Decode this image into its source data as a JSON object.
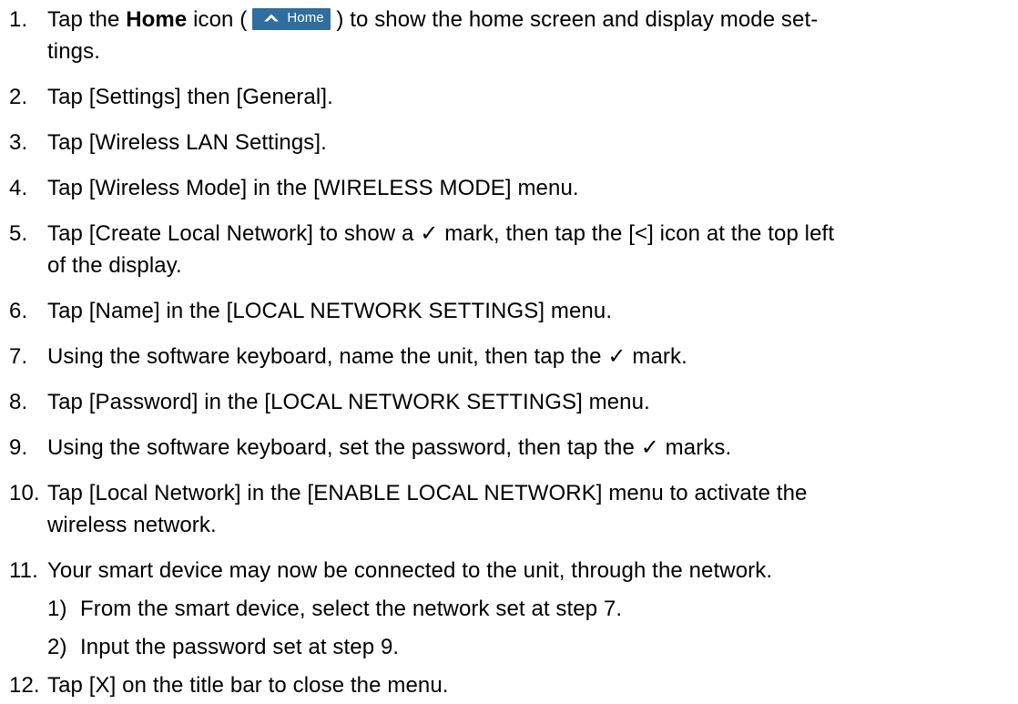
{
  "steps": [
    {
      "number": "1.",
      "lines": [
        {
          "before": "Tap the ",
          "bold": "Home",
          "middle": " icon (",
          "button_label": "Home",
          "after": ") to show the home screen and display mode set-"
        },
        {
          "text": "tings."
        }
      ]
    },
    {
      "number": "2.",
      "lines": [
        {
          "text": "Tap [Settings] then [General]."
        }
      ]
    },
    {
      "number": "3.",
      "lines": [
        {
          "text": "Tap [Wireless LAN Settings]."
        }
      ]
    },
    {
      "number": "4.",
      "lines": [
        {
          "text": "Tap [Wireless Mode] in the [WIRELESS MODE] menu."
        }
      ]
    },
    {
      "number": "5.",
      "lines": [
        {
          "text": "Tap [Create Local Network] to show a ✓ mark, then tap the [<] icon at the top left"
        },
        {
          "text": "of the display."
        }
      ]
    },
    {
      "number": "6.",
      "lines": [
        {
          "text": "Tap [Name] in the [LOCAL NETWORK SETTINGS] menu."
        }
      ]
    },
    {
      "number": "7.",
      "lines": [
        {
          "text": "Using the software keyboard, name the unit, then tap the ✓ mark."
        }
      ]
    },
    {
      "number": "8.",
      "lines": [
        {
          "text": "Tap [Password] in the [LOCAL NETWORK SETTINGS] menu."
        }
      ]
    },
    {
      "number": "9.",
      "lines": [
        {
          "text": "Using the software keyboard, set the password, then tap the ✓ marks."
        }
      ]
    },
    {
      "number": "10.",
      "lines": [
        {
          "text": "Tap [Local Network] in the [ENABLE LOCAL NETWORK] menu to activate the"
        },
        {
          "text": "wireless network."
        }
      ]
    },
    {
      "number": "11.",
      "lines": [
        {
          "text": "Your smart device may now be connected to the unit, through the network."
        }
      ]
    },
    {
      "number": "1)",
      "sub": true,
      "lines": [
        {
          "text": "From the smart device, select the network set at step 7."
        }
      ]
    },
    {
      "number": "2)",
      "sub": true,
      "lines": [
        {
          "text": "Input the password set at step 9."
        }
      ]
    },
    {
      "number": "12.",
      "lines": [
        {
          "text": "Tap [X] on the title bar to close the menu."
        }
      ]
    }
  ],
  "colors": {
    "home_button_bg": "#2f6e9e",
    "text": "#000000"
  },
  "icons": {
    "home_button_icon": "home-chevron-up-icon"
  }
}
